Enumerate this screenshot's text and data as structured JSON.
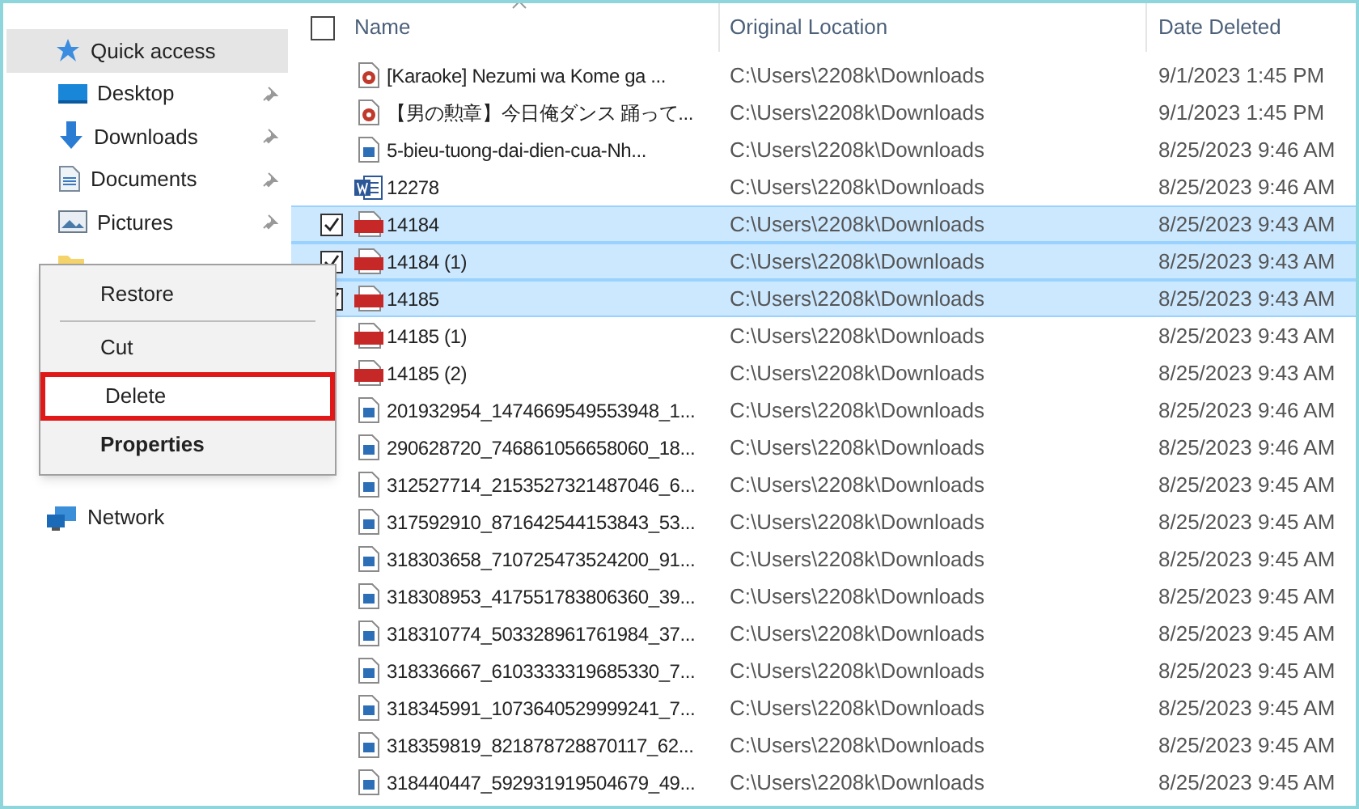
{
  "sidebar": {
    "items": [
      {
        "label": "Quick access",
        "kind": "star",
        "selected": true,
        "pinned": false
      },
      {
        "label": "Desktop",
        "kind": "desktop",
        "selected": false,
        "pinned": true
      },
      {
        "label": "Downloads",
        "kind": "download",
        "selected": false,
        "pinned": true
      },
      {
        "label": "Documents",
        "kind": "document",
        "selected": false,
        "pinned": true
      },
      {
        "label": "Pictures",
        "kind": "pictures",
        "selected": false,
        "pinned": true
      },
      {
        "kind": "folder",
        "selected": false
      }
    ],
    "bottom_items": [
      {
        "label": "Network",
        "kind": "network",
        "selected": false
      }
    ]
  },
  "table": {
    "columns": [
      "Name",
      "Original Location",
      "Date Deleted"
    ],
    "all_checked": false,
    "rows": [
      {
        "name": "[Karaoke] Nezumi wa Kome ga ...",
        "location": "C:\\Users\\2208k\\Downloads",
        "date": "9/1/2023 1:45 PM",
        "kind": "video",
        "selected": false
      },
      {
        "name": "【男の勲章】今日俺ダンス 踊って...",
        "location": "C:\\Users\\2208k\\Downloads",
        "date": "9/1/2023 1:45 PM",
        "kind": "video",
        "selected": false
      },
      {
        "name": "5-bieu-tuong-dai-dien-cua-Nh...",
        "location": "C:\\Users\\2208k\\Downloads",
        "date": "8/25/2023 9:46 AM",
        "kind": "image",
        "selected": false
      },
      {
        "name": "12278",
        "location": "C:\\Users\\2208k\\Downloads",
        "date": "8/25/2023 9:46 AM",
        "kind": "word",
        "selected": false
      },
      {
        "name": "14184",
        "location": "C:\\Users\\2208k\\Downloads",
        "date": "8/25/2023 9:43 AM",
        "kind": "pdf",
        "selected": true
      },
      {
        "name": "14184 (1)",
        "location": "C:\\Users\\2208k\\Downloads",
        "date": "8/25/2023 9:43 AM",
        "kind": "pdf",
        "selected": true
      },
      {
        "name": "14185",
        "location": "C:\\Users\\2208k\\Downloads",
        "date": "8/25/2023 9:43 AM",
        "kind": "pdf",
        "selected": true
      },
      {
        "name": "14185 (1)",
        "location": "C:\\Users\\2208k\\Downloads",
        "date": "8/25/2023 9:43 AM",
        "kind": "pdf",
        "selected": false
      },
      {
        "name": "14185 (2)",
        "location": "C:\\Users\\2208k\\Downloads",
        "date": "8/25/2023 9:43 AM",
        "kind": "pdf",
        "selected": false
      },
      {
        "name": "201932954_1474669549553948_1...",
        "location": "C:\\Users\\2208k\\Downloads",
        "date": "8/25/2023 9:46 AM",
        "kind": "image",
        "selected": false
      },
      {
        "name": "290628720_746861056658060_18...",
        "location": "C:\\Users\\2208k\\Downloads",
        "date": "8/25/2023 9:46 AM",
        "kind": "image",
        "selected": false
      },
      {
        "name": "312527714_2153527321487046_6...",
        "location": "C:\\Users\\2208k\\Downloads",
        "date": "8/25/2023 9:45 AM",
        "kind": "image",
        "selected": false
      },
      {
        "name": "317592910_871642544153843_53...",
        "location": "C:\\Users\\2208k\\Downloads",
        "date": "8/25/2023 9:45 AM",
        "kind": "image",
        "selected": false
      },
      {
        "name": "318303658_710725473524200_91...",
        "location": "C:\\Users\\2208k\\Downloads",
        "date": "8/25/2023 9:45 AM",
        "kind": "image",
        "selected": false
      },
      {
        "name": "318308953_417551783806360_39...",
        "location": "C:\\Users\\2208k\\Downloads",
        "date": "8/25/2023 9:45 AM",
        "kind": "image",
        "selected": false
      },
      {
        "name": "318310774_503328961761984_37...",
        "location": "C:\\Users\\2208k\\Downloads",
        "date": "8/25/2023 9:45 AM",
        "kind": "image",
        "selected": false
      },
      {
        "name": "318336667_6103333319685330_7...",
        "location": "C:\\Users\\2208k\\Downloads",
        "date": "8/25/2023 9:45 AM",
        "kind": "image",
        "selected": false
      },
      {
        "name": "318345991_1073640529999241_7...",
        "location": "C:\\Users\\2208k\\Downloads",
        "date": "8/25/2023 9:45 AM",
        "kind": "image",
        "selected": false
      },
      {
        "name": "318359819_821878728870117_62...",
        "location": "C:\\Users\\2208k\\Downloads",
        "date": "8/25/2023 9:45 AM",
        "kind": "image",
        "selected": false
      },
      {
        "name": "318440447_592931919504679_49...",
        "location": "C:\\Users\\2208k\\Downloads",
        "date": "8/25/2023 9:45 AM",
        "kind": "image",
        "selected": false
      }
    ]
  },
  "context_menu": {
    "items": [
      {
        "label": "Restore",
        "bold": false,
        "highlighted": false,
        "separator_after": true
      },
      {
        "label": "Cut",
        "bold": false,
        "highlighted": false,
        "separator_after": false
      },
      {
        "label": "Delete",
        "bold": false,
        "highlighted": true,
        "separator_after": false
      },
      {
        "label": "Properties",
        "bold": true,
        "highlighted": false,
        "separator_after": false
      }
    ]
  }
}
